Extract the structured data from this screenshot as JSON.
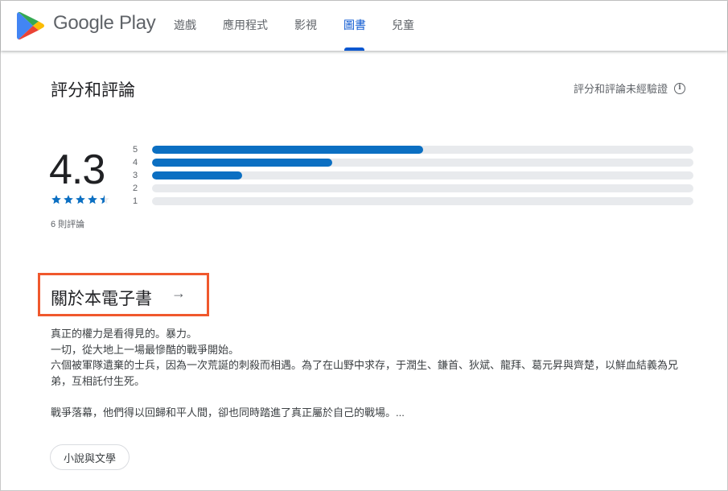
{
  "header": {
    "brand": "Google Play",
    "nav": [
      {
        "label": "遊戲",
        "active": false
      },
      {
        "label": "應用程式",
        "active": false
      },
      {
        "label": "影視",
        "active": false
      },
      {
        "label": "圖書",
        "active": true
      },
      {
        "label": "兒童",
        "active": false
      }
    ]
  },
  "ratings": {
    "title": "評分和評論",
    "unverified_label": "評分和評論未經驗證",
    "info_icon": "info-icon",
    "score": "4.3",
    "stars": {
      "value": 4.3,
      "max": 5
    },
    "review_count": "6 則評論",
    "distribution": [
      {
        "label": "5",
        "fraction": 0.5
      },
      {
        "label": "4",
        "fraction": 0.333
      },
      {
        "label": "3",
        "fraction": 0.167
      },
      {
        "label": "2",
        "fraction": 0
      },
      {
        "label": "1",
        "fraction": 0
      }
    ]
  },
  "about": {
    "title": "關於本電子書",
    "arrow_icon": "arrow-right-icon",
    "lines": [
      "真正的權力是看得見的。暴力。",
      "一切，從大地上一場最慘酷的戰爭開始。",
      "六個被軍隊遺棄的士兵，因為一次荒誕的刺殺而相遇。為了在山野中求存，于潤生、鎌首、狄斌、龍拜、葛元昇與齊楚，以鮮血結義為兄弟，互相託付生死。",
      "",
      "戰爭落幕，他們得以回歸和平人間，卻也同時踏進了真正屬於自己的戰場。..."
    ],
    "genre_chip": "小說與文學"
  },
  "colors": {
    "accent": "#0b57d0",
    "bar_fill": "#0b6fc2",
    "bar_track": "#e8eaed",
    "highlight_box": "#f0582d"
  }
}
